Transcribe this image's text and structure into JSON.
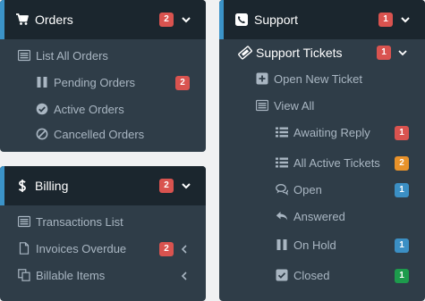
{
  "colors": {
    "panel_bg": "#2f3d48",
    "header_bg": "#1b262e",
    "accent": "#3b93c8",
    "badge_red": "#d9534f",
    "badge_orange": "#e8922a",
    "badge_blue": "#3b8fc4",
    "badge_green": "#1d9b4c",
    "text_muted": "#a9b6c2"
  },
  "orders": {
    "title": "Orders",
    "icon": "cart-icon",
    "badge": "2",
    "items": [
      {
        "label": "List All Orders",
        "icon": "list-icon"
      },
      {
        "label": "Pending Orders",
        "icon": "pause-icon",
        "badge": "2"
      },
      {
        "label": "Active Orders",
        "icon": "check-circle-icon"
      },
      {
        "label": "Cancelled Orders",
        "icon": "ban-icon"
      }
    ]
  },
  "billing": {
    "title": "Billing",
    "icon": "dollar-icon",
    "badge": "2",
    "items": [
      {
        "label": "Transactions List",
        "icon": "list-icon"
      },
      {
        "label": "Invoices Overdue",
        "icon": "file-icon",
        "badge": "2"
      },
      {
        "label": "Billable Items",
        "icon": "copy-icon"
      }
    ]
  },
  "support": {
    "title": "Support",
    "icon": "phone-icon",
    "badge": "1",
    "tickets": {
      "label": "Support Tickets",
      "icon": "ticket-icon",
      "badge": "1"
    },
    "items": [
      {
        "label": "Open New Ticket",
        "icon": "plus-square-icon"
      },
      {
        "label": "View All",
        "icon": "list-icon"
      }
    ],
    "subitems": [
      {
        "label": "Awaiting Reply",
        "icon": "list-icon",
        "badge": "1"
      },
      {
        "label": "All Active Tickets",
        "icon": "list-icon",
        "badge": "2"
      },
      {
        "label": "Open",
        "icon": "comments-icon",
        "badge": "1"
      },
      {
        "label": "Answered",
        "icon": "reply-icon"
      },
      {
        "label": "On Hold",
        "icon": "pause-icon",
        "badge": "1"
      },
      {
        "label": "Closed",
        "icon": "check-square-icon",
        "badge": "1"
      }
    ]
  }
}
